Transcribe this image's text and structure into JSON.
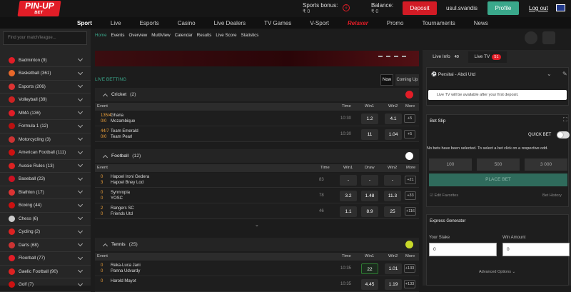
{
  "header": {
    "logo_main": "PIN-UP",
    "logo_sub": "BET",
    "sports_bonus_label": "Sports bonus:",
    "sports_bonus_value": "₹ 0",
    "balance_label": "Balance:",
    "balance_value": "₹ 0",
    "deposit": "Deposit",
    "username": "usul.svandis",
    "profile": "Profile",
    "logout": "Log out",
    "flag_icon": "uk-flag-icon"
  },
  "nav": [
    "Sport",
    "Live",
    "Esports",
    "Casino",
    "Live Dealers",
    "TV Games",
    "V-Sport",
    "Relaxer",
    "Promo",
    "Tournaments",
    "News"
  ],
  "search": {
    "placeholder": "Find your match/league..."
  },
  "sports": [
    "Badminton (9)",
    "Basketball (361)",
    "Esports (206)",
    "Volleyball (39)",
    "MMA (136)",
    "Formula 1 (12)",
    "Motorcycling (3)",
    "American Football (111)",
    "Aussie Rules (13)",
    "Baseball (23)",
    "Biathlon (17)",
    "Boxing (44)",
    "Chess (6)",
    "Cycling (2)",
    "Darts (68)",
    "Floorball (77)",
    "Gaelic Football (90)",
    "Golf (7)"
  ],
  "tabs": [
    "Home",
    "Events",
    "Overview",
    "MultiView",
    "Calendar",
    "Results",
    "Live Score",
    "Statistics"
  ],
  "live_betting": "LIVE BETTING",
  "now": "Now",
  "coming_up": "Coming Up",
  "cricket": {
    "name": "Cricket",
    "count": "(2)",
    "headers": [
      "Event",
      "Time",
      "Win1",
      "Win2",
      "More"
    ],
    "rows": [
      {
        "s1": "135/4",
        "s2": "0/0",
        "t1": "Ghana",
        "t2": "Mozambique",
        "time": "10:30",
        "o1": "1.2",
        "o2": "4.1",
        "more": "+5"
      },
      {
        "s1": "44/7",
        "s2": "0/0",
        "t1": "Team Emerald",
        "t2": "Team Pearl",
        "time": "10:30",
        "o1": "11",
        "o2": "1.04",
        "more": "+5"
      }
    ]
  },
  "football": {
    "name": "Football",
    "count": "(12)",
    "headers": [
      "Event",
      "Time",
      "Win1",
      "Draw",
      "Win2",
      "More"
    ],
    "rows": [
      {
        "s1": "0",
        "s2": "3",
        "t1": "Hapoel Ironi Gedera",
        "t2": "Hapoel Bney Lod",
        "time": "83",
        "o1": "-",
        "o2": "-",
        "o3": "-",
        "more": "+21"
      },
      {
        "s1": "0",
        "s2": "0",
        "t1": "Synnropia",
        "t2": "YOSC",
        "time": "78",
        "o1": "3.2",
        "o2": "1.48",
        "o3": "11.3",
        "more": "+33"
      },
      {
        "s1": "2",
        "s2": "0",
        "t1": "Rangers SC",
        "t2": "Friends Utd",
        "time": "46",
        "o1": "1.1",
        "o2": "8.9",
        "o3": "25",
        "more": "+116"
      }
    ]
  },
  "tennis": {
    "name": "Tennis",
    "count": "(25)",
    "headers": [
      "Event",
      "Time",
      "Win1",
      "Win2",
      "More"
    ],
    "rows": [
      {
        "s1": "0",
        "s2": "0",
        "t1": "Reka-Luca Jani",
        "t2": "Panna Udvardy",
        "time": "10:35",
        "o1": "22",
        "o2": "1.01",
        "more": "+133"
      },
      {
        "s1": "0",
        "s2": "",
        "t1": "Harold Mayot",
        "t2": "",
        "time": "10:35",
        "o1": "4.45",
        "o2": "1.19",
        "more": "+133"
      }
    ]
  },
  "right": {
    "live_info": "Live Info",
    "live_info_count": "40",
    "live_tv": "Live TV",
    "live_tv_count": "51",
    "match": "Persitai - Abdi Utd",
    "tv_notice": "Live TV will be available after your first deposit.",
    "bet_slip": "Bet Slip",
    "quick_bet": "QUICK BET",
    "no_bets": "No bets have been selected. To select a bet click on a respective odd.",
    "stakes": [
      "100",
      "500",
      "3 000"
    ],
    "place_bet": "PLACE BET",
    "edit_fav": "Edit Favorites",
    "bet_history": "Bet History",
    "express": "Express Generator",
    "your_stake": "Your Stake",
    "win_amount": "Win Amount",
    "stake_val": "0",
    "win_val": "0",
    "advanced": "Advanced Options"
  }
}
